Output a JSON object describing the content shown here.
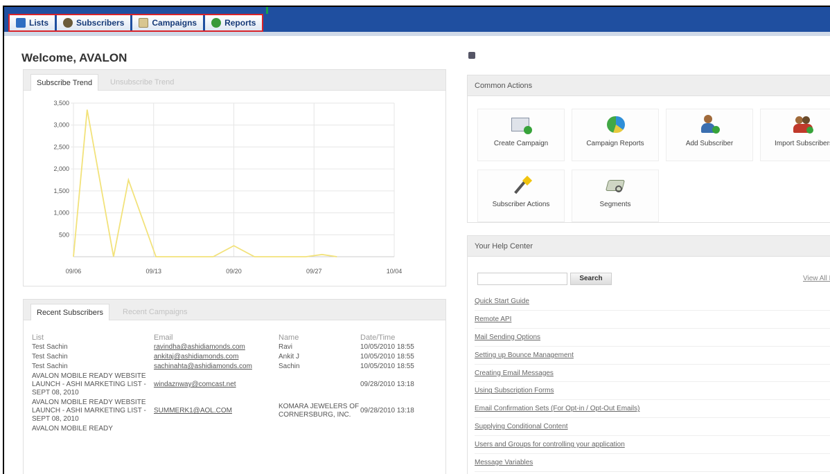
{
  "nav": {
    "tabs": [
      {
        "label": "Lists",
        "icon": "lists-icon",
        "color": "#2e6dc2"
      },
      {
        "label": "Subscribers",
        "icon": "subscribers-icon",
        "color": "#6b5b3a"
      },
      {
        "label": "Campaigns",
        "icon": "campaigns-icon",
        "color": "#b8a36a"
      },
      {
        "label": "Reports",
        "icon": "reports-icon",
        "color": "#3a9a3a"
      }
    ]
  },
  "welcome": "Welcome, AVALON",
  "trend": {
    "tabs": [
      "Subscribe Trend",
      "Unsubscribe Trend"
    ]
  },
  "chart_data": {
    "type": "line",
    "x_ticks": [
      "09/06",
      "09/13",
      "09/20",
      "09/27",
      "10/04"
    ],
    "y_ticks": [
      "3,500",
      "3,000",
      "2,500",
      "2,000",
      "1,500",
      "1,000",
      "500"
    ],
    "ylim": [
      0,
      3500
    ],
    "line_color": "#f2e27a",
    "series": [
      {
        "x": [
          0,
          1.2,
          3.5,
          4.8,
          7.2,
          12.2,
          14.0,
          15.8,
          17.5,
          20.3,
          21.7,
          23.0
        ]
      },
      {
        "y": [
          0,
          3350,
          0,
          1750,
          0,
          0,
          250,
          0,
          0,
          0,
          50,
          0
        ]
      }
    ]
  },
  "recent": {
    "tabs": [
      "Recent Subscribers",
      "Recent Campaigns"
    ],
    "columns": [
      "List",
      "Email",
      "Name",
      "Date/Time"
    ],
    "rows": [
      {
        "list": "Test Sachin",
        "email": "ravindha@ashidiamonds.com",
        "name": "Ravi",
        "date": "10/05/2010 18:55"
      },
      {
        "list": "Test Sachin",
        "email": "ankitaj@ashidiamonds.com",
        "name": "Ankit J",
        "date": "10/05/2010 18:55"
      },
      {
        "list": "Test Sachin",
        "email": "sachinahta@ashidiamonds.com",
        "name": "Sachin",
        "date": "10/05/2010 18:55"
      },
      {
        "list": "AVALON MOBILE READY WEBSITE LAUNCH - ASHI MARKETING LIST - SEPT 08, 2010",
        "email": "windaznway@comcast.net",
        "name": "",
        "date": "09/28/2010 13:18"
      },
      {
        "list": "AVALON MOBILE READY WEBSITE LAUNCH - ASHI MARKETING LIST - SEPT 08, 2010",
        "email": "SUMMERK1@AOL.COM",
        "name": "KOMARA JEWELERS OF CORNERSBURG, INC.",
        "date": "09/28/2010 13:18"
      },
      {
        "list": "AVALON MOBILE READY",
        "email": "",
        "name": "",
        "date": ""
      }
    ]
  },
  "actions": {
    "title": "Common Actions",
    "items": [
      {
        "label": "Create Campaign",
        "icon": "create-campaign-icon"
      },
      {
        "label": "Campaign Reports",
        "icon": "campaign-reports-icon"
      },
      {
        "label": "Add Subscriber",
        "icon": "add-subscriber-icon"
      },
      {
        "label": "Import Subscribers",
        "icon": "import-subscribers-icon"
      },
      {
        "label": "Subscriber Actions",
        "icon": "subscriber-actions-icon"
      },
      {
        "label": "Segments",
        "icon": "segments-icon"
      }
    ]
  },
  "help": {
    "title": "Your Help Center",
    "search_button": "Search",
    "view_all": "View All H",
    "links": [
      "Quick Start Guide",
      "Remote API",
      "Mail Sending Options",
      "Setting up Bounce Management",
      "Creating Email Messages",
      "Using Subscription Forms",
      "Email Confirmation Sets (For Opt-in / Opt-Out Emails)",
      "Supplying Conditional Content",
      "Users and Groups for controlling your application",
      "Message Variables"
    ]
  }
}
